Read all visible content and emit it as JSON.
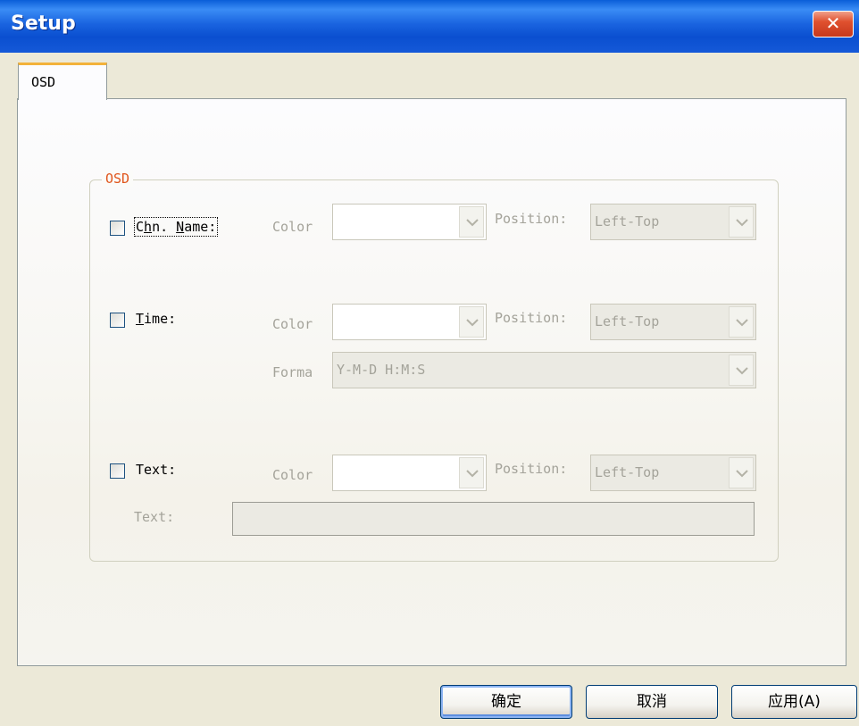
{
  "window": {
    "title": "Setup",
    "close_label": "✕"
  },
  "tabs": [
    {
      "label": "OSD"
    }
  ],
  "osd_group": {
    "legend": "OSD",
    "chn_name": {
      "label_pre": "C",
      "label_u1": "h",
      "label_mid": "n. ",
      "label_u2": "N",
      "label_post": "ame:",
      "checked": false,
      "color_label": "Color",
      "color_value": "",
      "position_label": "Position:",
      "position_value": "Left-Top"
    },
    "time": {
      "label_u": "T",
      "label_post": "ime:",
      "checked": false,
      "color_label": "Color",
      "color_value": "",
      "position_label": "Position:",
      "position_value": "Left-Top",
      "format_label": "Forma",
      "format_value": "Y-M-D H:M:S"
    },
    "text": {
      "label": "Text:",
      "checked": false,
      "color_label": "Color",
      "color_value": "",
      "position_label": "Position:",
      "position_value": "Left-Top",
      "text_field_label": "Text:",
      "text_field_value": ""
    }
  },
  "buttons": {
    "ok": "确定",
    "cancel": "取消",
    "apply": "应用(A)"
  },
  "colors": {
    "title_bar": "#0a5ed8",
    "tab_highlight": "#f3b23a",
    "legend": "#e0561d",
    "disabled_text": "#a4a39a"
  }
}
